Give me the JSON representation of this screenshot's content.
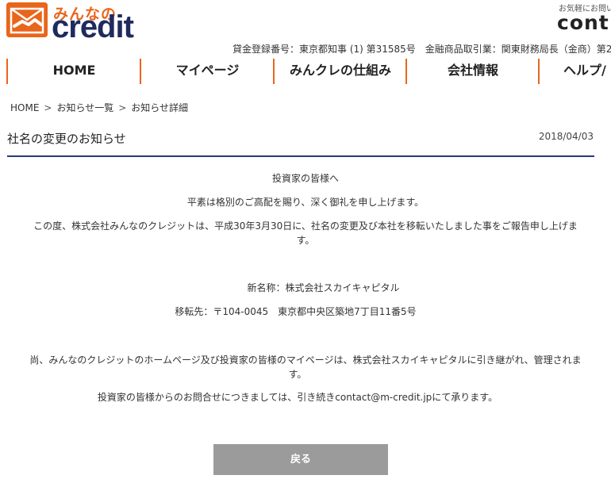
{
  "header": {
    "logo_small": "みんなの",
    "logo_big": "credit",
    "contact_top": "お気軽にお問い",
    "contact_big": "cont",
    "registration": "貸金登録番号：東京都知事 (1) 第31585号　金融商品取引業：関東財務局長（金商）第2"
  },
  "nav": {
    "items": [
      {
        "label": "HOME"
      },
      {
        "label": "マイページ"
      },
      {
        "label": "みんクレの仕組み"
      },
      {
        "label": "会社情報"
      },
      {
        "label": "ヘルプ/"
      }
    ]
  },
  "breadcrumb": {
    "items": [
      "HOME",
      "お知らせ一覧",
      "お知らせ詳細"
    ],
    "separator": ">"
  },
  "article": {
    "title": "社名の変更のお知らせ",
    "date": "2018/04/03",
    "greeting": "投資家の皆様へ",
    "thanks": "平素は格別のご高配を賜り、深く御礼を申し上げます。",
    "announce_line1": "この度、株式会社みんなのクレジットは、平成30年3月30日に、社名の変更及び本社を移転いたしました事をご報告申し上げま",
    "announce_line2": "す。",
    "new_name": "新名称：株式会社スカイキャピタル",
    "new_address": "移転先：〒104-0045　東京都中央区築地7丁目11番5号",
    "website_line1": "尚、みんなのクレジットのホームページ及び投資家の皆様のマイページは、株式会社スカイキャピタルに引き継がれ、管理されま",
    "website_line2": "す。",
    "inquiry": "投資家の皆様からのお問合せにつきましては、引き続きcontact@m-credit.jpにて承ります。"
  },
  "back_button": {
    "label": "戻る"
  },
  "colors": {
    "brand_orange": "#e8661c",
    "brand_navy": "#1f2a5e",
    "title_rule": "#253a7a",
    "button_gray": "#9b9b9b"
  },
  "icons": {
    "logo": "handshake-icon"
  }
}
